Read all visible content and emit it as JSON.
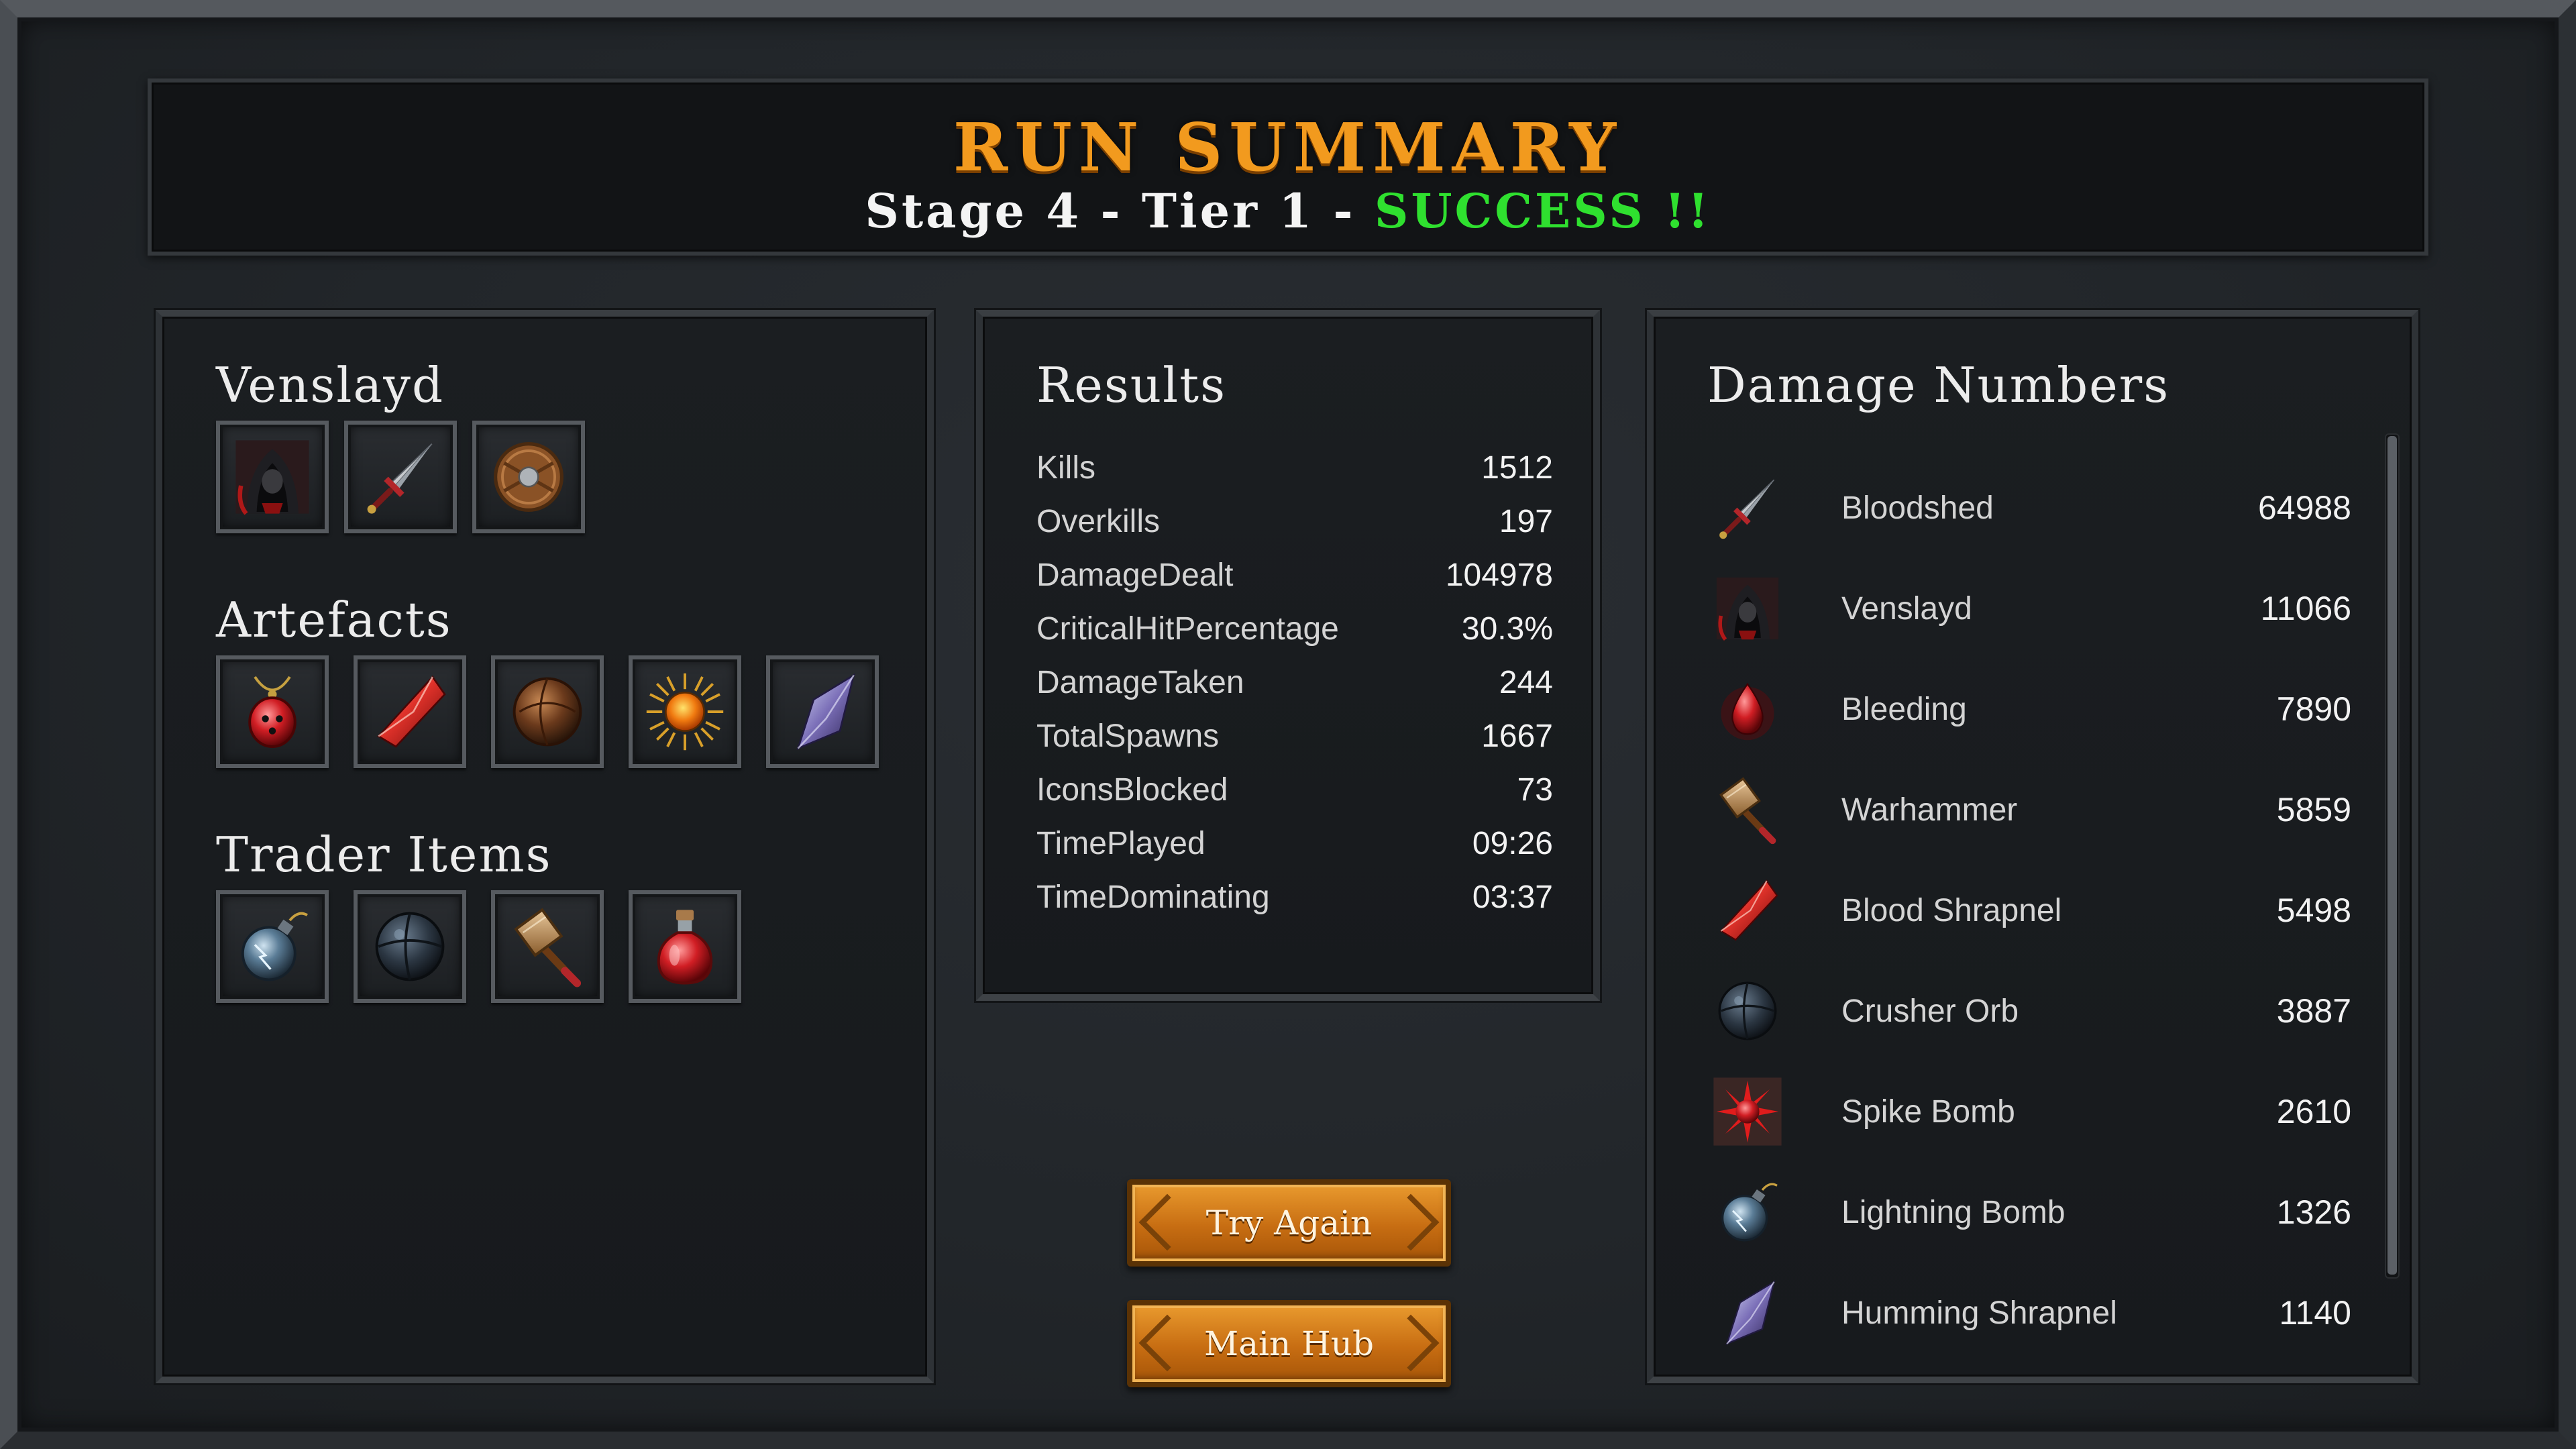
{
  "header": {
    "title": "RUN SUMMARY",
    "subtitle_prefix": "Stage 4 - Tier 1 - ",
    "subtitle_status": "SUCCESS !!",
    "status_color": "#2fe02f",
    "title_color": "#f29a1e"
  },
  "character": {
    "name": "Venslayd",
    "loadout_icons": [
      "hooded-warrior-icon",
      "sword-icon",
      "round-shield-icon"
    ]
  },
  "artefacts": {
    "heading": "Artefacts",
    "icons": [
      "red-pendant-icon",
      "blood-shard-icon",
      "bronze-orb-icon",
      "sun-orb-icon",
      "violet-crystal-icon"
    ]
  },
  "trader_items": {
    "heading": "Trader Items",
    "icons": [
      "lightning-bomb-icon",
      "crusher-orb-icon",
      "warhammer-icon",
      "red-potion-icon"
    ]
  },
  "results": {
    "heading": "Results",
    "rows": [
      {
        "label": "Kills",
        "value": "1512"
      },
      {
        "label": "Overkills",
        "value": "197"
      },
      {
        "label": "DamageDealt",
        "value": "104978"
      },
      {
        "label": "CriticalHitPercentage",
        "value": "30.3%"
      },
      {
        "label": "DamageTaken",
        "value": "244"
      },
      {
        "label": "TotalSpawns",
        "value": "1667"
      },
      {
        "label": "IconsBlocked",
        "value": "73"
      },
      {
        "label": "TimePlayed",
        "value": "09:26"
      },
      {
        "label": "TimeDominating",
        "value": "03:37"
      }
    ]
  },
  "damage": {
    "heading": "Damage Numbers",
    "rows": [
      {
        "icon": "sword-icon",
        "name": "Bloodshed",
        "value": "64988"
      },
      {
        "icon": "hooded-warrior-icon",
        "name": "Venslayd",
        "value": "11066"
      },
      {
        "icon": "blood-drop-icon",
        "name": "Bleeding",
        "value": "7890"
      },
      {
        "icon": "warhammer-icon",
        "name": "Warhammer",
        "value": "5859"
      },
      {
        "icon": "blood-shard-icon",
        "name": "Blood Shrapnel",
        "value": "5498"
      },
      {
        "icon": "crusher-orb-icon",
        "name": "Crusher Orb",
        "value": "3887"
      },
      {
        "icon": "spike-bomb-icon",
        "name": "Spike Bomb",
        "value": "2610"
      },
      {
        "icon": "lightning-bomb-icon",
        "name": "Lightning Bomb",
        "value": "1326"
      },
      {
        "icon": "violet-crystal-icon",
        "name": "Humming Shrapnel",
        "value": "1140"
      }
    ]
  },
  "buttons": {
    "try_again": "Try Again",
    "main_hub": "Main Hub"
  }
}
